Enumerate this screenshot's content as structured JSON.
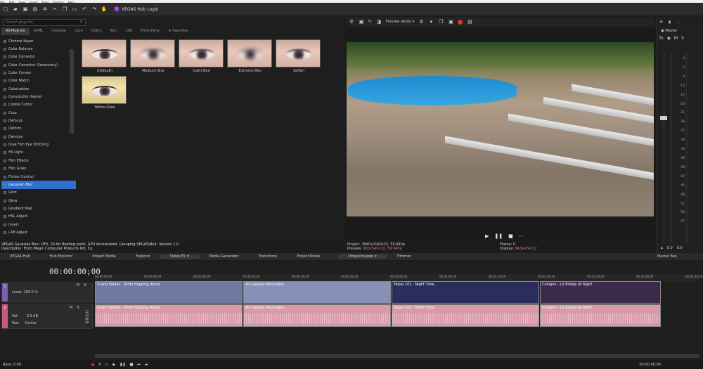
{
  "menu": [
    "File",
    "Edit",
    "View",
    "Insert",
    "Tools",
    "Options",
    "Help"
  ],
  "toolbar": {
    "hub_login": "VEGAS Hub Login",
    "hub_logo": "V"
  },
  "fx_panel": {
    "search_placeholder": "Search plug-ins",
    "categories": [
      "All Plug-ins",
      "AI/ML",
      "Creative",
      "Core",
      "Utility",
      "Blur",
      "360",
      "Third Party",
      "Favorites"
    ],
    "plugins": [
      "Chroma Keyer",
      "Color Balance",
      "Color Corrector",
      "Color Corrector (Secondary)",
      "Color Curves",
      "Color Match",
      "Colorization",
      "Convolution Kernel",
      "Cookie Cutter",
      "Crop",
      "Defocus",
      "Deform",
      "Denoise",
      "Dual Fish Eye Stitching",
      "Fill Light",
      "Film Effects",
      "Film Grain",
      "Flicker Control",
      "Gaussian Blur",
      "Glint",
      "Glow",
      "Gradient Map",
      "HSL Adjust",
      "Invert",
      "LAB Adjust"
    ],
    "selected_plugin": "Gaussian Blur",
    "presets": [
      "(Default)",
      "Medium Blur",
      "Light Blur",
      "Extreme Blur",
      "Soften",
      "Yellow Glow"
    ],
    "description_line1": "VEGAS Gaussian Blur: OFX, 32-bit floating point, GPU Accelerated, Grouping VEGAS\\Blur, Version 1.0",
    "description_line2": "Description: From Magic Computer Products Intl. Co."
  },
  "preview": {
    "mode": "Preview (Auto)",
    "project_label": "Project:",
    "project_value": "3840x2160x32, 59.940p",
    "preview_label": "Preview:",
    "preview_value": "960x540x32, 59.940p",
    "frame_label": "Frame:",
    "frame_value": "0",
    "display_label": "Display:",
    "display_value": "843x474x32"
  },
  "master": {
    "title": "Master",
    "fx": "fx",
    "m": "M",
    "s": "S",
    "scale": [
      "3",
      "6",
      "9",
      "12",
      "15",
      "18",
      "21",
      "24",
      "27",
      "30",
      "33",
      "36",
      "39",
      "42",
      "45",
      "48",
      "51",
      "54",
      "57"
    ],
    "val_left": "0.0",
    "val_right": "0.0"
  },
  "tabs": [
    "VEGAS Hub",
    "Hub Explorer",
    "Project Media",
    "Explorer",
    "Video FX",
    "Media Generator",
    "Transitions",
    "Project Notes",
    "Video Preview",
    "Trimmer",
    "Master Bus"
  ],
  "timeline": {
    "timecode": "00:00:00;00",
    "ruler": [
      "00:00:00;00",
      "00:00:09;29",
      "00:00:19;29",
      "00:00:29;29",
      "00:00:39;29",
      "00:00:49;29",
      "00:01:00;00",
      "00:01:09;29",
      "00:01:19;29",
      "00:01:29;29",
      "00:01:39;29",
      "00:01:49;29",
      "00:01:59;29"
    ],
    "video_track": {
      "number": "1",
      "level_label": "Level:",
      "level_value": "100.0 %",
      "m": "M",
      "s": "S"
    },
    "audio_track": {
      "number": "2",
      "vol_label": "Vol:",
      "vol_value": "0.0 dB",
      "pan_label": "Pan:",
      "pan_value": "Center",
      "m": "M",
      "s": "S",
      "scale": [
        "12",
        "24",
        "36",
        "48"
      ]
    },
    "clips": [
      "Grand Wailea - Birds Hopping About",
      "Air Canada Mountains",
      "Taipei 101 - Night Time",
      "Cologne - LX Bridge At Night"
    ]
  },
  "status": {
    "rate": "Rate: 0.00",
    "end_time": "00:00:00;00"
  }
}
